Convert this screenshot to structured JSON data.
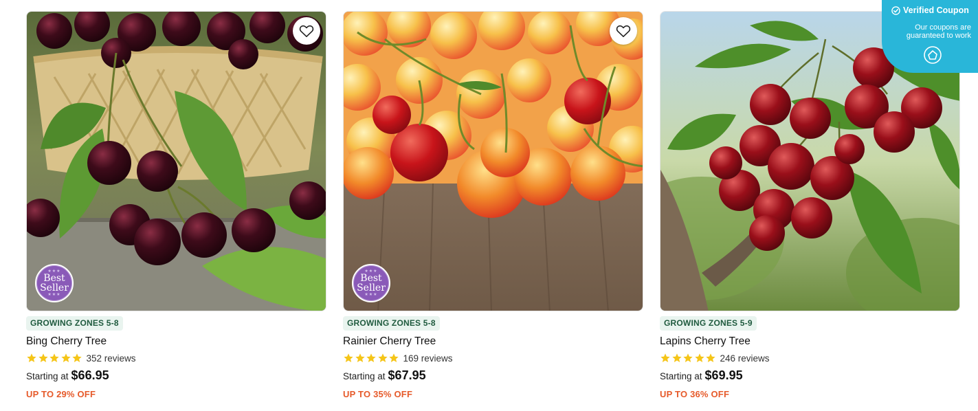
{
  "coupon": {
    "title": "Verified Coupon",
    "subtitle": "Our coupons are guaranteed to work",
    "icons": [
      "check-circle-icon",
      "shield-logo-icon"
    ],
    "color": "#29b6d9"
  },
  "products": [
    {
      "zone": "GROWING ZONES 5-8",
      "name": "Bing Cherry Tree",
      "rating": 5,
      "reviews": "352 reviews",
      "starting": "Starting at",
      "price": "$66.95",
      "discount": "UP TO 29% OFF",
      "best_seller": true,
      "badge": [
        "Best",
        "Seller"
      ],
      "image": "dark-cherries-basket",
      "favorite_icon": "heart-icon"
    },
    {
      "zone": "GROWING ZONES 5-8",
      "name": "Rainier Cherry Tree",
      "rating": 5,
      "reviews": "169 reviews",
      "starting": "Starting at",
      "price": "$67.95",
      "discount": "UP TO 35% OFF",
      "best_seller": true,
      "badge": [
        "Best",
        "Seller"
      ],
      "image": "rainier-cherries-wood",
      "favorite_icon": "heart-icon"
    },
    {
      "zone": "GROWING ZONES 5-9",
      "name": "Lapins Cherry Tree",
      "rating": 5,
      "reviews": "246 reviews",
      "starting": "Starting at",
      "price": "$69.95",
      "discount": "UP TO 36% OFF",
      "best_seller": false,
      "image": "cherries-on-branch",
      "favorite_icon": "heart-icon"
    }
  ],
  "colors": {
    "zone_bg": "#e9f4ef",
    "zone_text": "#1f5a3e",
    "star": "#f5c518",
    "discount": "#e65a2a",
    "badge": "#8a5ab8"
  }
}
